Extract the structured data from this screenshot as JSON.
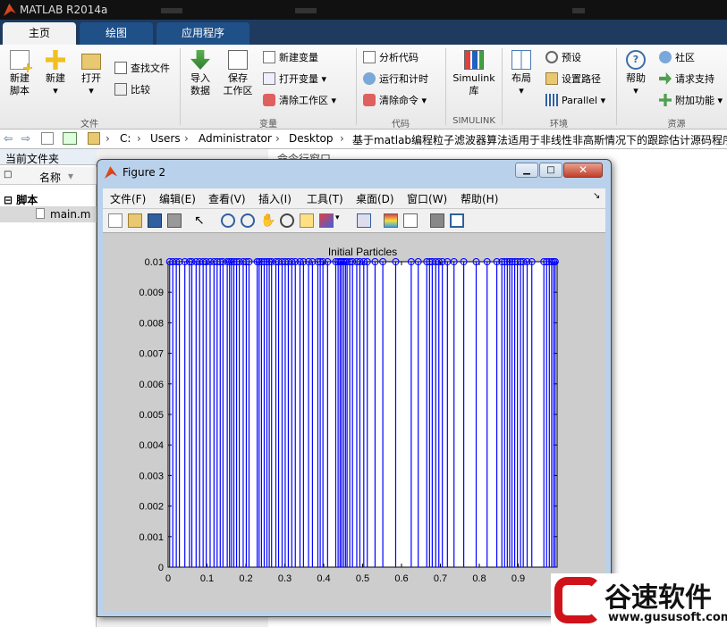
{
  "app": {
    "title": "MATLAB R2014a"
  },
  "tabs": [
    {
      "label": "主页",
      "active": true
    },
    {
      "label": "绘图",
      "active": false
    },
    {
      "label": "应用程序",
      "active": false
    }
  ],
  "ribbon": {
    "file": {
      "new_script": [
        "新建",
        "脚本"
      ],
      "new": "新建",
      "open": "打开",
      "find_files": "查找文件",
      "compare": "比较",
      "group": "文件"
    },
    "variable": {
      "import": [
        "导入",
        "数据"
      ],
      "save": [
        "保存",
        "工作区"
      ],
      "new_var": "新建变量",
      "open_var": "打开变量",
      "clear_ws": "清除工作区",
      "group": "变量"
    },
    "code": {
      "analyze": "分析代码",
      "run_time": "运行和计时",
      "clear_cmd": "清除命令",
      "group": "代码"
    },
    "simulink": {
      "label": [
        "Simulink",
        "库"
      ],
      "group": "SIMULINK"
    },
    "env": {
      "layout": "布局",
      "prefs": "预设",
      "set_path": "设置路径",
      "parallel": "Parallel",
      "group": "环境"
    },
    "resources": {
      "help": "帮助",
      "community": "社区",
      "support": "请求支持",
      "addons": "附加功能",
      "group": "资源"
    }
  },
  "address": {
    "segments": [
      "C:",
      "Users",
      "Administrator",
      "Desktop",
      "基于matlab编程粒子滤波器算法适用于非线性非高斯情况下的跟踪估计源码程序"
    ]
  },
  "left_panel": {
    "title": "当前文件夹",
    "col_name": "名称",
    "folder": "脚本",
    "file": "main.m"
  },
  "right_panel": {
    "title": "命令行窗口"
  },
  "figure": {
    "title": "Figure 2",
    "menu": [
      "文件(F)",
      "编辑(E)",
      "查看(V)",
      "插入(I)",
      "工具(T)",
      "桌面(D)",
      "窗口(W)",
      "帮助(H)"
    ]
  },
  "chart_data": {
    "type": "stem",
    "title": "Initial Particles",
    "xlabel": "",
    "ylabel": "",
    "xlim": [
      0,
      1
    ],
    "ylim": [
      0,
      0.01
    ],
    "xticks": [
      "0",
      "0.1",
      "0.2",
      "0.3",
      "0.4",
      "0.5",
      "0.6",
      "0.7",
      "0.8",
      "0.9",
      "1"
    ],
    "yticks": [
      "0",
      "0.001",
      "0.002",
      "0.003",
      "0.004",
      "0.005",
      "0.006",
      "0.007",
      "0.008",
      "0.009",
      "0.01"
    ],
    "color": "#0000ff",
    "series": [
      {
        "x": [
          0.004,
          0.012,
          0.021,
          0.029,
          0.043,
          0.055,
          0.061,
          0.072,
          0.081,
          0.09,
          0.098,
          0.108,
          0.118,
          0.126,
          0.134,
          0.141,
          0.152,
          0.158,
          0.163,
          0.169,
          0.176,
          0.183,
          0.193,
          0.201,
          0.208,
          0.229,
          0.234,
          0.24,
          0.247,
          0.254,
          0.26,
          0.266,
          0.277,
          0.284,
          0.293,
          0.301,
          0.309,
          0.318,
          0.327,
          0.339,
          0.348,
          0.361,
          0.371,
          0.385,
          0.391,
          0.398,
          0.41,
          0.431,
          0.437,
          0.442,
          0.446,
          0.451,
          0.456,
          0.46,
          0.467,
          0.474,
          0.485,
          0.493,
          0.503,
          0.512,
          0.532,
          0.552,
          0.585,
          0.625,
          0.643,
          0.665,
          0.672,
          0.679,
          0.688,
          0.696,
          0.705,
          0.718,
          0.735,
          0.76,
          0.792,
          0.82,
          0.845,
          0.858,
          0.865,
          0.872,
          0.878,
          0.884,
          0.891,
          0.898,
          0.906,
          0.913,
          0.923,
          0.935,
          0.966,
          0.973,
          0.98,
          0.986,
          0.991,
          0.995
        ],
        "y": 0.01
      }
    ]
  },
  "watermark": {
    "brand": "谷速软件",
    "url": "www.gususoft.com"
  }
}
